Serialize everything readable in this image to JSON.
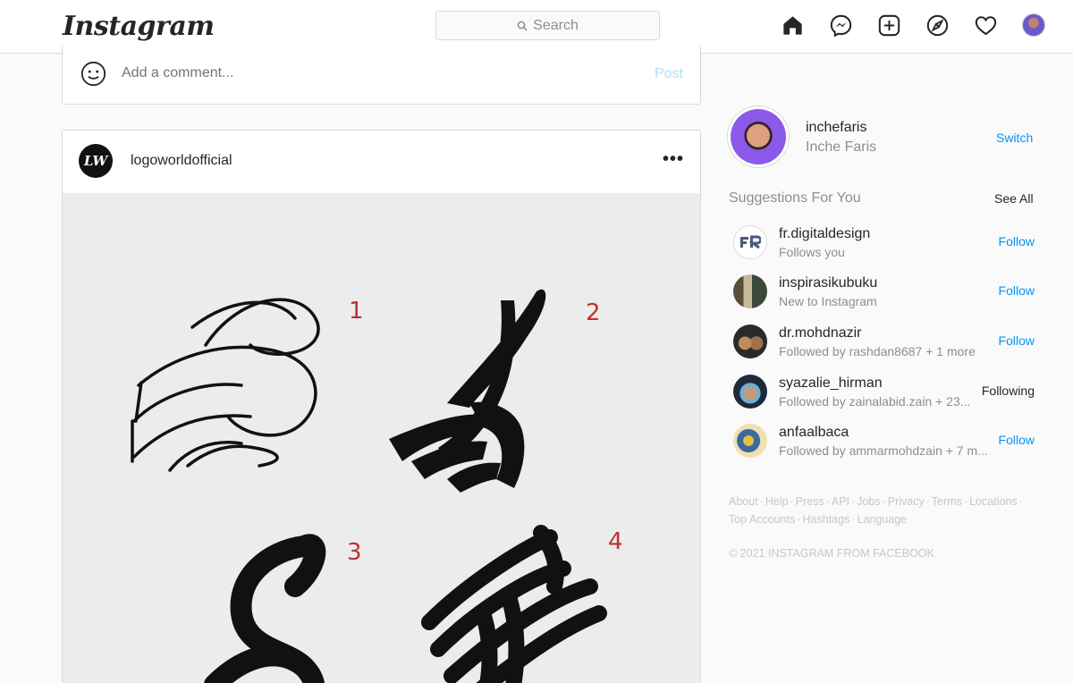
{
  "nav": {
    "logo": "Instagram",
    "search_placeholder": "Search",
    "icons": [
      "home-icon",
      "messenger-icon",
      "new-post-icon",
      "explore-icon",
      "activity-heart-icon",
      "profile-avatar"
    ]
  },
  "previous_post": {
    "comment_placeholder": "Add a comment...",
    "post_label": "Post"
  },
  "post": {
    "avatar_text": "LW",
    "username": "logoworldofficial",
    "more_label": "•••",
    "image_numbers": [
      "1",
      "2",
      "3",
      "4"
    ]
  },
  "profile": {
    "username": "inchefaris",
    "full_name": "Inche Faris",
    "switch_label": "Switch"
  },
  "suggestions": {
    "title": "Suggestions For You",
    "see_all": "See All",
    "items": [
      {
        "username": "fr.digitaldesign",
        "subtitle": "Follows you",
        "action": "Follow"
      },
      {
        "username": "inspirasikubuku",
        "subtitle": "New to Instagram",
        "action": "Follow"
      },
      {
        "username": "dr.mohdnazir",
        "subtitle": "Followed by rashdan8687 + 1 more",
        "action": "Follow"
      },
      {
        "username": "syazalie_hirman",
        "subtitle": "Followed by zainalabid.zain + 23...",
        "action": "Following"
      },
      {
        "username": "anfaalbaca",
        "subtitle": "Followed by ammarmohdzain + 7 m...",
        "action": "Follow"
      }
    ]
  },
  "footer": {
    "links": [
      "About",
      "Help",
      "Press",
      "API",
      "Jobs",
      "Privacy",
      "Terms",
      "Locations",
      "Top Accounts",
      "Hashtags",
      "Language"
    ],
    "copyright": "© 2021 INSTAGRAM FROM FACEBOOK"
  },
  "colors": {
    "accent": "#0095f6",
    "muted_text": "#8e8e8e",
    "border": "#dbdbdb",
    "background": "#fafafa"
  }
}
